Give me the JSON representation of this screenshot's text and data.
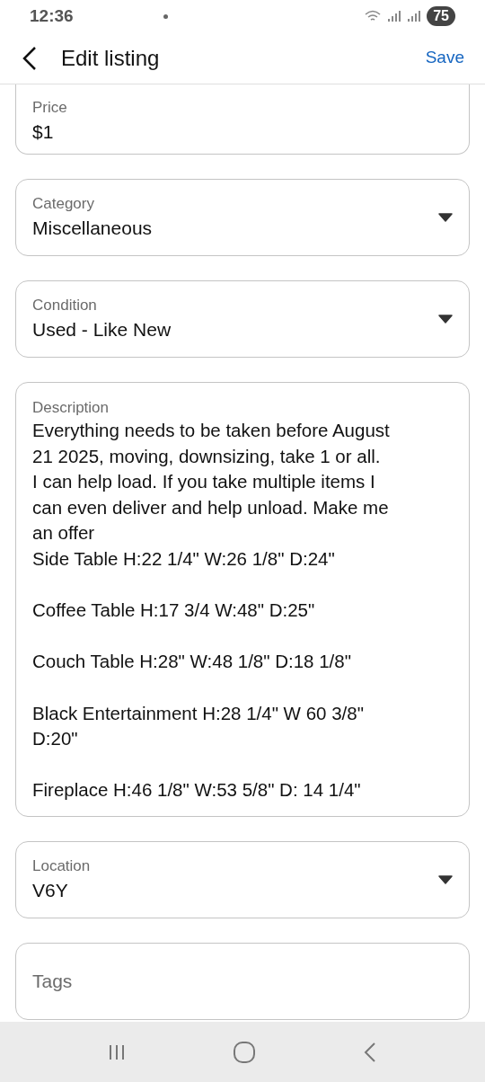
{
  "status_bar": {
    "time": "12:36",
    "battery": "75"
  },
  "header": {
    "title": "Edit listing",
    "action": "Save"
  },
  "fields": [
    {
      "kind": "text",
      "label": "Price",
      "value": "$1",
      "cut_top": true
    },
    {
      "kind": "dropdown",
      "label": "Category",
      "value": "Miscellaneous"
    },
    {
      "kind": "dropdown",
      "label": "Condition",
      "value": "Used - Like New"
    },
    {
      "kind": "multiline",
      "label": "Description",
      "value": "Everything needs to be taken before August\n21 2025, moving, downsizing, take 1 or all.\nI can help load. If you take multiple items I\ncan even deliver and help unload. Make me\nan offer\nSide Table H:22 1/4\" W:26 1/8\" D:24\"\n\nCoffee Table H:17 3/4 W:48\" D:25\"\n\nCouch Table H:28\" W:48 1/8\" D:18 1/8\"\n\nBlack Entertainment H:28 1/4\" W 60 3/8\"\nD:20\"\n\nFireplace H:46 1/8\" W:53 5/8\" D: 14 1/4\""
    },
    {
      "kind": "dropdown",
      "label": "Location",
      "value": "V6Y"
    },
    {
      "kind": "empty",
      "placeholder": "Tags"
    }
  ]
}
